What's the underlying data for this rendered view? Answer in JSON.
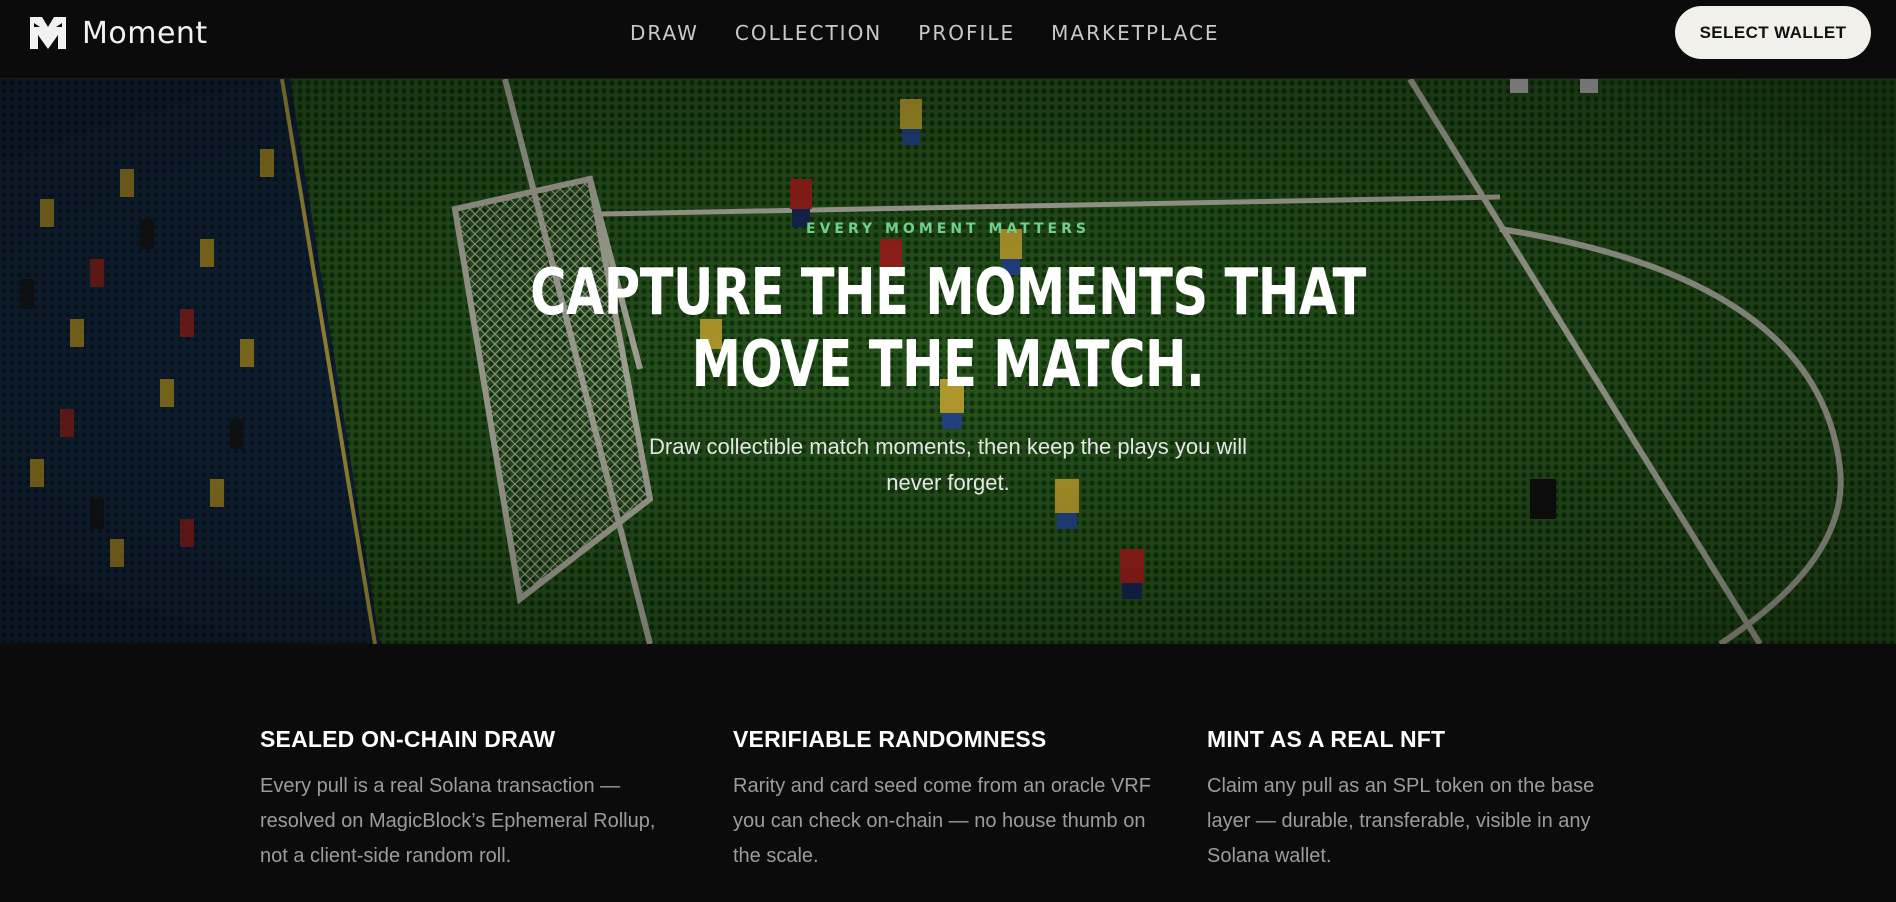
{
  "header": {
    "brand": "Moment",
    "logo_icon": "moment-m-logo",
    "nav": [
      {
        "label": "DRAW"
      },
      {
        "label": "COLLECTION"
      },
      {
        "label": "PROFILE"
      },
      {
        "label": "MARKETPLACE"
      }
    ],
    "wallet_button": "SELECT WALLET"
  },
  "hero": {
    "eyebrow": "EVERY MOMENT MATTERS",
    "title_line1": "Capture the moments that",
    "title_line2": "move the match.",
    "subtitle": "Draw collectible match moments, then keep the plays you will never forget.",
    "background": "halftone-soccer-goalmouth-illustration"
  },
  "features": [
    {
      "title": "SEALED ON-CHAIN DRAW",
      "body": "Every pull is a real Solana transaction — resolved on MagicBlock’s Ephemeral Rollup, not a client-side random roll."
    },
    {
      "title": "VERIFIABLE RANDOMNESS",
      "body": "Rarity and card seed come from an oracle VRF you can check on-chain — no house thumb on the scale."
    },
    {
      "title": "MINT AS A REAL NFT",
      "body": "Claim any pull as an SPL token on the base layer — durable, transferable, visible in any Solana wallet."
    }
  ],
  "colors": {
    "background": "#0b0b0b",
    "accent_green": "#6fd18a",
    "button_bg": "#f1f0ea",
    "pitch_green": "#1d4a14"
  }
}
